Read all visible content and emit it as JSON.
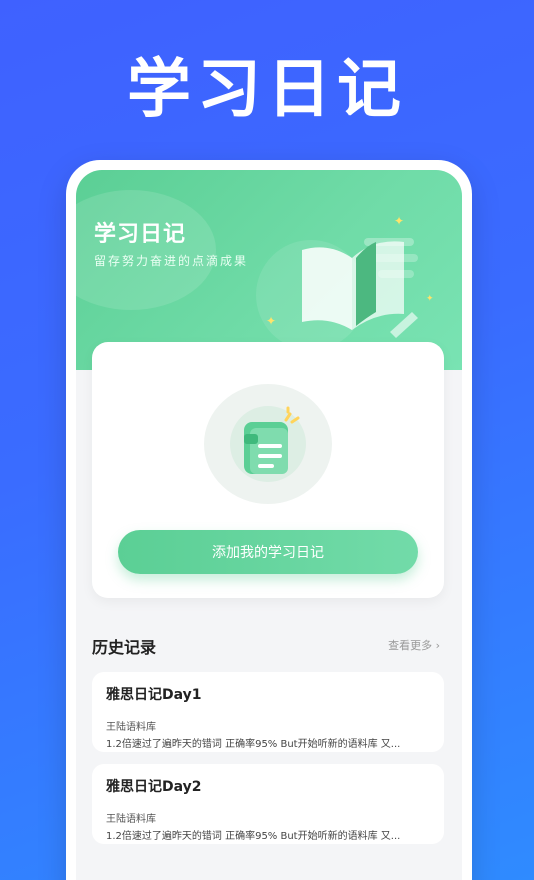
{
  "hero_title": "学习日记",
  "banner": {
    "title": "学习日记",
    "subtitle": "留存努力奋进的点滴成果"
  },
  "card": {
    "add_button": "添加我的学习日记"
  },
  "history": {
    "title": "历史记录",
    "more": "查看更多 ›",
    "entries": [
      {
        "title": "雅思日记Day1",
        "source": "王陆语料库",
        "text": "1.2倍速过了遍昨天的错词 正确率95% But开始听新的语料库 又..."
      },
      {
        "title": "雅思日记Day2",
        "source": "王陆语料库",
        "text": "1.2倍速过了遍昨天的错词 正确率95% But开始听新的语料库 又..."
      }
    ]
  },
  "colors": {
    "background": "#3f61ff",
    "accent": "#5bcf95"
  },
  "icons": [
    "book-icon",
    "notebook-icon",
    "sparkle-icon",
    "chevron-right-icon"
  ]
}
